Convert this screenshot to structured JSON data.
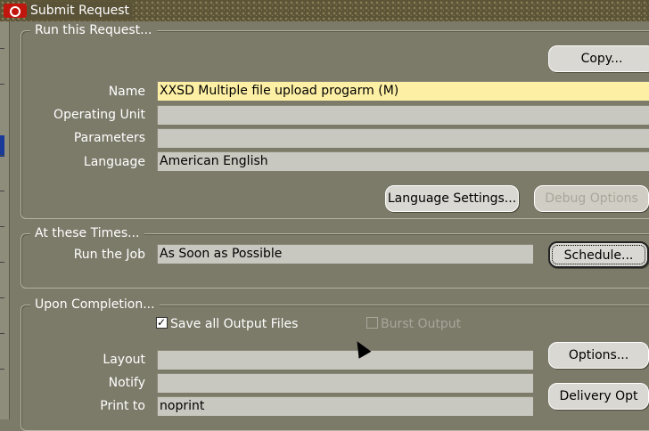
{
  "window": {
    "title": "Submit Request"
  },
  "run_request": {
    "legend": "Run this Request...",
    "copy_button": "Copy...",
    "name_label": "Name",
    "name_value": "XXSD Multiple file upload progarm (M)",
    "operating_unit_label": "Operating Unit",
    "operating_unit_value": "",
    "parameters_label": "Parameters",
    "parameters_value": "",
    "language_label": "Language",
    "language_value": "American English",
    "language_settings_button": "Language Settings...",
    "debug_options_button": "Debug Options"
  },
  "times": {
    "legend": "At these Times...",
    "run_job_label": "Run the Job",
    "run_job_value": "As Soon as Possible",
    "schedule_button": "Schedule..."
  },
  "completion": {
    "legend": "Upon Completion...",
    "save_output_label": "Save all Output Files",
    "save_output_checked": true,
    "burst_output_label": "Burst Output",
    "layout_label": "Layout",
    "layout_value": "",
    "notify_label": "Notify",
    "notify_value": "",
    "print_to_label": "Print to",
    "print_to_value": "noprint",
    "options_button": "Options...",
    "delivery_button": "Delivery Opt"
  },
  "colors": {
    "background": "#7c7a69",
    "titlebar": "#5c5436",
    "name_field": "#fdf0a5",
    "field": "#c9c8c0",
    "button": "#d9d8d2"
  }
}
